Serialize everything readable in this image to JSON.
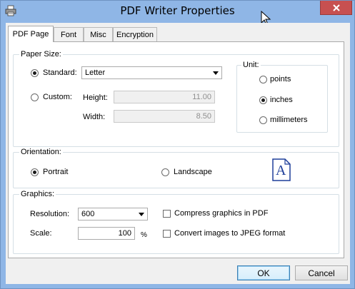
{
  "window": {
    "title": "PDF Writer Properties"
  },
  "tabs": [
    {
      "label": "PDF Page",
      "active": true
    },
    {
      "label": "Font",
      "active": false
    },
    {
      "label": "Misc",
      "active": false
    },
    {
      "label": "Encryption",
      "active": false
    }
  ],
  "paper_size": {
    "group_label": "Paper Size:",
    "standard_label": "Standard:",
    "standard_checked": true,
    "standard_value": "Letter",
    "custom_label": "Custom:",
    "custom_checked": false,
    "height_label": "Height:",
    "height_value": "11.00",
    "width_label": "Width:",
    "width_value": "8.50"
  },
  "unit": {
    "group_label": "Unit:",
    "options": [
      {
        "label": "points",
        "checked": false
      },
      {
        "label": "inches",
        "checked": true
      },
      {
        "label": "millimeters",
        "checked": false
      }
    ]
  },
  "orientation": {
    "group_label": "Orientation:",
    "portrait_label": "Portrait",
    "portrait_checked": true,
    "landscape_label": "Landscape",
    "landscape_checked": false,
    "preview_letter": "A"
  },
  "graphics": {
    "group_label": "Graphics:",
    "resolution_label": "Resolution:",
    "resolution_value": "600",
    "scale_label": "Scale:",
    "scale_value": "100",
    "scale_unit": "%",
    "compress_label": "Compress graphics in PDF",
    "compress_checked": false,
    "jpeg_label": "Convert images to JPEG format",
    "jpeg_checked": false
  },
  "buttons": {
    "ok_label": "OK",
    "cancel_label": "Cancel"
  },
  "colors": {
    "title_bar": "#8fb6e6",
    "close_button": "#c75050",
    "dialog_bg": "#f0f0f0",
    "document_icon": "#1f3f9a"
  }
}
